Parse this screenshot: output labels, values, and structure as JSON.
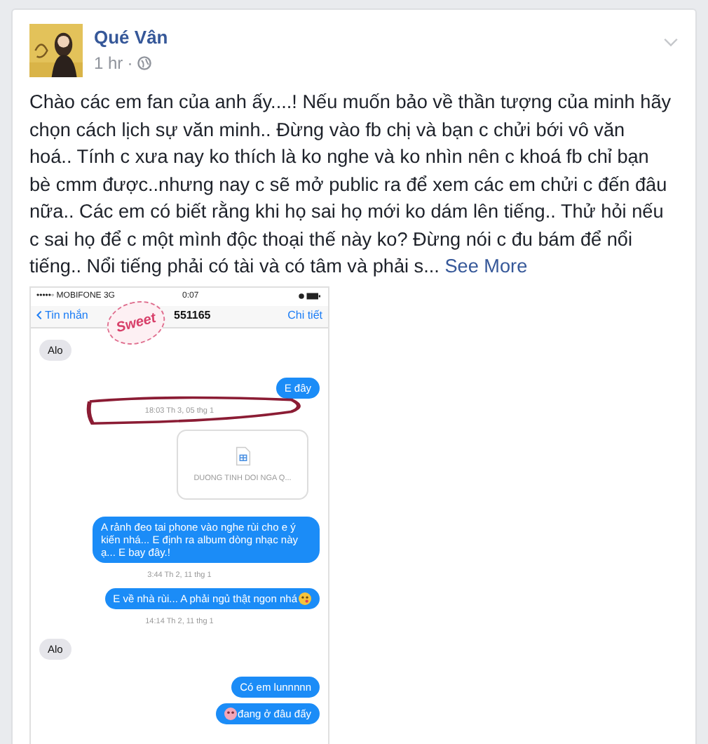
{
  "post": {
    "author": "Qué Vân",
    "time": "1 hr",
    "separator": "·",
    "body": "Chào các em fan của anh ấy....! Nếu muốn bảo về thần tượng của minh hãy chọn cách lịch sự văn minh.. Đừng vào fb chị và bạn c chửi bới vô văn hoá.. Tính c xưa nay ko thích là ko nghe và ko nhìn nên c khoá fb chỉ bạn bè cmm được..nhưng nay c sẽ mở public ra để xem các em chửi c đến đâu nữa.. Các em có biết rằng khi họ sai họ mới ko dám lên tiếng.. Thử hỏi nếu c sai họ để c một mình độc thoại thế này ko? Đừng nói c đu bám để nổi tiếng.. Nổi tiếng phải có tài và có tâm và phải s...",
    "see_more": "See More"
  },
  "screenshot": {
    "status_bar": {
      "carrier": "•••••◦ MOBIFONE  3G",
      "time": "0:07"
    },
    "nav": {
      "back": "Tin nhắn",
      "title": "551165",
      "detail": "Chi tiết"
    },
    "sticker": "Sweet",
    "messages": [
      {
        "kind": "received",
        "text": "Alo"
      },
      {
        "kind": "sent",
        "text": "E đây"
      },
      {
        "kind": "timestamp",
        "text": "18:03 Th 3, 05 thg 1",
        "circled": true
      },
      {
        "kind": "file",
        "text": "DUONG TINH DOI NGA Q..."
      },
      {
        "kind": "sent",
        "text": "A rảnh đeo tai phone vào nghe rùi cho e ý kiến nhá... E định ra album dòng nhạc này ạ... E bay đây.!"
      },
      {
        "kind": "timestamp",
        "text": "3:44 Th 2, 11 thg 1",
        "circled": false
      },
      {
        "kind": "sent",
        "text": "E về nhà rùi... A phải ngủ thật ngon nhá",
        "emoji_after": true
      },
      {
        "kind": "timestamp",
        "text": "14:14 Th 2, 11 thg 1",
        "circled": false
      },
      {
        "kind": "received",
        "text": "Alo"
      },
      {
        "kind": "sent",
        "text": "Có em lunnnnn"
      },
      {
        "kind": "sent",
        "text": "đang ở đâu đấy",
        "emoji_before": true
      }
    ]
  }
}
